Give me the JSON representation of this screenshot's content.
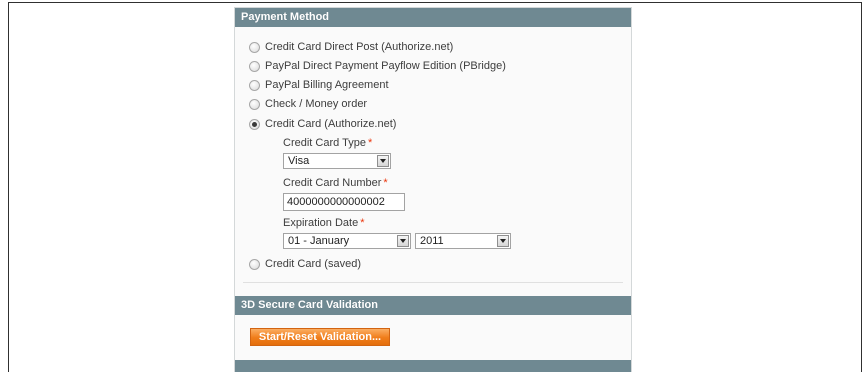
{
  "sections": {
    "payment_title": "Payment Method",
    "secure_title": "3D Secure Card Validation"
  },
  "methods": [
    {
      "label": "Credit Card Direct Post (Authorize.net)",
      "checked": false
    },
    {
      "label": "PayPal Direct Payment Payflow Edition (PBridge)",
      "checked": false
    },
    {
      "label": "PayPal Billing Agreement",
      "checked": false
    },
    {
      "label": "Check / Money order",
      "checked": false
    },
    {
      "label": "Credit Card (Authorize.net)",
      "checked": true
    },
    {
      "label": "Credit Card (saved)",
      "checked": false
    }
  ],
  "form": {
    "card_type_label": "Credit Card Type",
    "card_type_value": "Visa",
    "card_number_label": "Credit Card Number",
    "card_number_value": "4000000000000002",
    "expiration_label": "Expiration Date",
    "exp_month_value": "01 - January",
    "exp_year_value": "2011",
    "required_mark": "*"
  },
  "buttons": {
    "validation": "Start/Reset Validation..."
  },
  "colors": {
    "header_bg": "#6f8992",
    "button_orange": "#f07d1a",
    "required_red": "#eb340a"
  }
}
